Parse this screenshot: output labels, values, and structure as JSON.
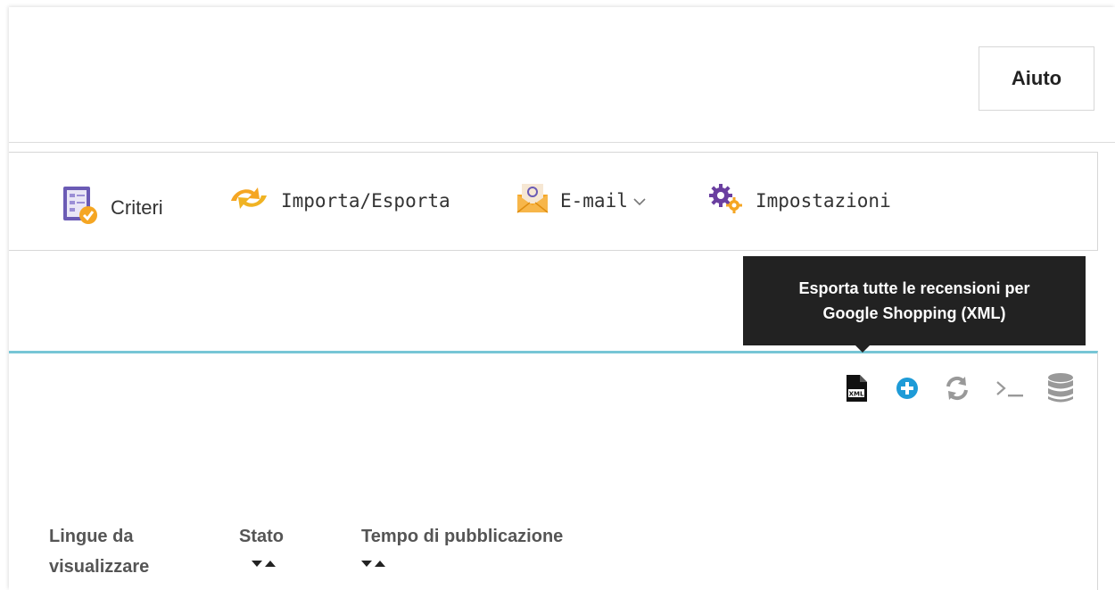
{
  "header": {
    "help_label": "Aiuto"
  },
  "menu": {
    "items": [
      {
        "label": "Criteri",
        "icon": "criteria-checklist-icon"
      },
      {
        "label": "Importa/Esporta",
        "icon": "import-export-arrows-icon"
      },
      {
        "label": "E-mail",
        "icon": "email-envelope-icon",
        "has_dropdown": true
      },
      {
        "label": "Impostazioni",
        "icon": "settings-gears-icon"
      }
    ]
  },
  "tooltip": {
    "line1": "Esporta tutte le recensioni per",
    "line2": "Google Shopping (XML)"
  },
  "toolbar": {
    "icons": [
      "xml-file-icon",
      "add-circle-icon",
      "refresh-icon",
      "terminal-icon",
      "database-icon"
    ]
  },
  "table": {
    "headers": [
      {
        "line1": "Lingue da",
        "line2": "visualizzare"
      },
      {
        "label": "Stato"
      },
      {
        "label": "Tempo di pubblicazione"
      }
    ]
  },
  "colors": {
    "accent_line": "#77c6d6",
    "add_icon": "#1e9bd7",
    "tooltip_bg": "#222222",
    "criteria_icon": "#6b5bb5",
    "settings_icon": "#6a3fa0",
    "orange": "#f5a623"
  }
}
